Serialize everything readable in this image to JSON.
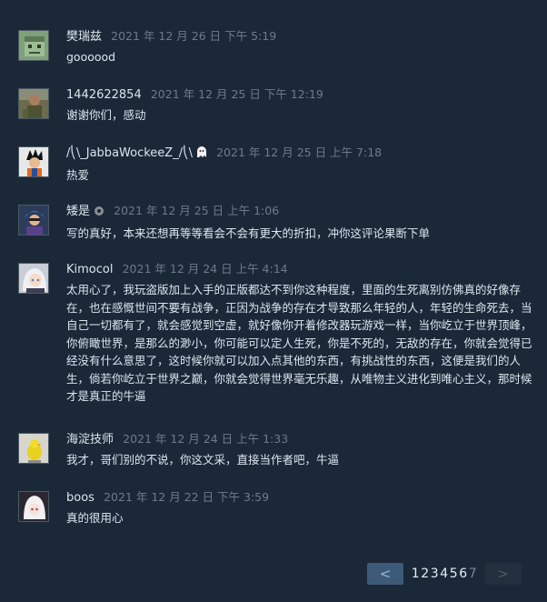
{
  "comments": [
    {
      "author": "樊瑞兹",
      "time": "2021 年 12 月 26 日 下午 5:19",
      "text": "goooood",
      "avatar": "green-face-avatar"
    },
    {
      "author": "1442622854",
      "time": "2021 年 12 月 25 日 下午 12:19",
      "text": "谢谢你们，感动",
      "avatar": "soldier-avatar"
    },
    {
      "author": "/⎝\\_JabbaWockeeZ_/⎝\\",
      "time": "2021 年 12 月 25 日 上午 7:18",
      "text": "热爱",
      "avatar": "goku-avatar",
      "badge": "ghost-icon"
    },
    {
      "author": "矮是",
      "time": "2021 年 12 月 25 日 上午 1:06",
      "text": "写的真好，本来还想再等等看会不会有更大的折扣，冲你这评论果断下单",
      "avatar": "blue-hair-avatar",
      "badge": "gear-icon"
    },
    {
      "author": "Kimocol",
      "time": "2021 年 12 月 24 日 上午 4:14",
      "text": "太用心了，我玩盗版加上入手的正版都达不到你这种程度，里面的生死离别仿佛真的好像存在，也在感慨世间不要有战争，正因为战争的存在才导致那么年轻的人，年轻的生命死去，当自己一切都有了，就会感觉到空虚，就好像你开着修改器玩游戏一样，当你屹立于世界顶峰，你俯瞰世界，是那么的渺小，你可能可以定人生死，你是不死的，无敌的存在，你就会觉得已经没有什么意思了，这时候你就可以加入点其他的东西，有挑战性的东西，这便是我们的人生，倘若你屹立于世界之巅，你就会觉得世界毫无乐趣，从唯物主义进化到唯心主义，那时候才是真正的牛逼",
      "avatar": "anime-girl-avatar"
    },
    {
      "author": "海淀技师",
      "time": "2021 年 12 月 24 日 上午 1:33",
      "text": "我才，哥们别的不说，你这文采，直接当作者吧，牛逼",
      "avatar": "yellow-bird-avatar"
    },
    {
      "author": "boos",
      "time": "2021 年 12 月 22 日 下午 3:59",
      "text": "真的很用心",
      "avatar": "white-hair-avatar"
    }
  ],
  "pagination": {
    "prev": "<",
    "next": ">",
    "pages": [
      "1",
      "2",
      "3",
      "4",
      "5",
      "6",
      "7"
    ],
    "current": "1"
  },
  "colors": {
    "background": "#1b2838",
    "accent": "#3d5b78"
  }
}
